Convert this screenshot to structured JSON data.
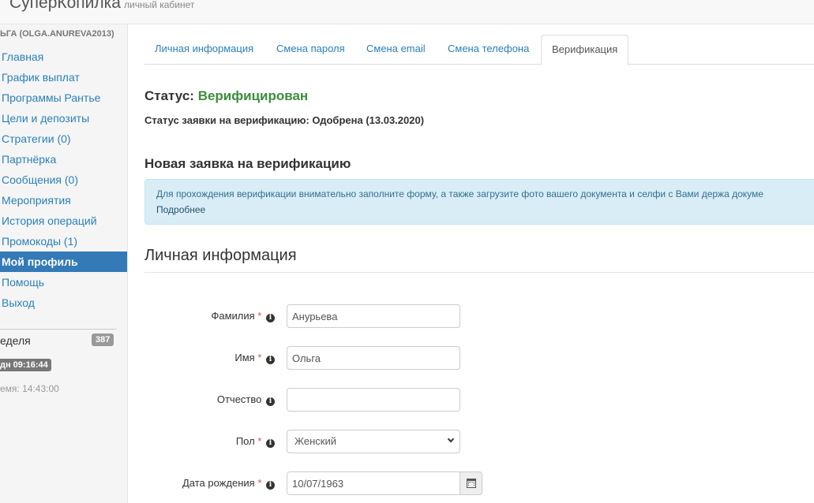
{
  "header": {
    "brand": "СуперКопилка",
    "subtitle": "личный кабинет"
  },
  "sidebar": {
    "user": "ЬГА (OLGA.ANUREVA2013)",
    "items": [
      {
        "label": "Главная"
      },
      {
        "label": "График выплат"
      },
      {
        "label": "Программы Рантье"
      },
      {
        "label": "Цели и депозиты"
      },
      {
        "label": "Стратегии (0)"
      },
      {
        "label": "Партнёрка"
      },
      {
        "label": "Сообщения (0)"
      },
      {
        "label": "Мероприятия"
      },
      {
        "label": "История операций"
      },
      {
        "label": "Промокоды (1)"
      },
      {
        "label": "Мой профиль"
      },
      {
        "label": "Помощь"
      },
      {
        "label": "Выход"
      }
    ],
    "active_index": 10,
    "week_label": "еделя",
    "week_count": "387",
    "timer": "дн 09:16:44",
    "time_text": "емя: 14:43:00"
  },
  "tabs": [
    {
      "label": "Личная информация"
    },
    {
      "label": "Смена пароля"
    },
    {
      "label": "Смена email"
    },
    {
      "label": "Смена телефона"
    },
    {
      "label": "Верификация"
    }
  ],
  "active_tab": "Верификация",
  "status": {
    "label": "Статус:",
    "value": "Верифицирован"
  },
  "request_status": "Статус заявки на верификацию: Одобрена (13.03.2020)",
  "new_request_title": "Новая заявка на верификацию",
  "alert": {
    "text": "Для прохождения верификации внимательно заполните форму, а также загрузите фото вашего документа и селфи с Вами держа докуме",
    "link": "Подробнее"
  },
  "section_title": "Личная информация",
  "form": {
    "required_mark": "*",
    "info_glyph": "i",
    "lastname": {
      "label": "Фамилия",
      "value": "Анурьева"
    },
    "firstname": {
      "label": "Имя",
      "value": "Ольга"
    },
    "middlename": {
      "label": "Отчество",
      "value": ""
    },
    "gender": {
      "label": "Пол",
      "value": "Женский"
    },
    "birthdate": {
      "label": "Дата рождения",
      "value": "10/07/1963"
    }
  }
}
